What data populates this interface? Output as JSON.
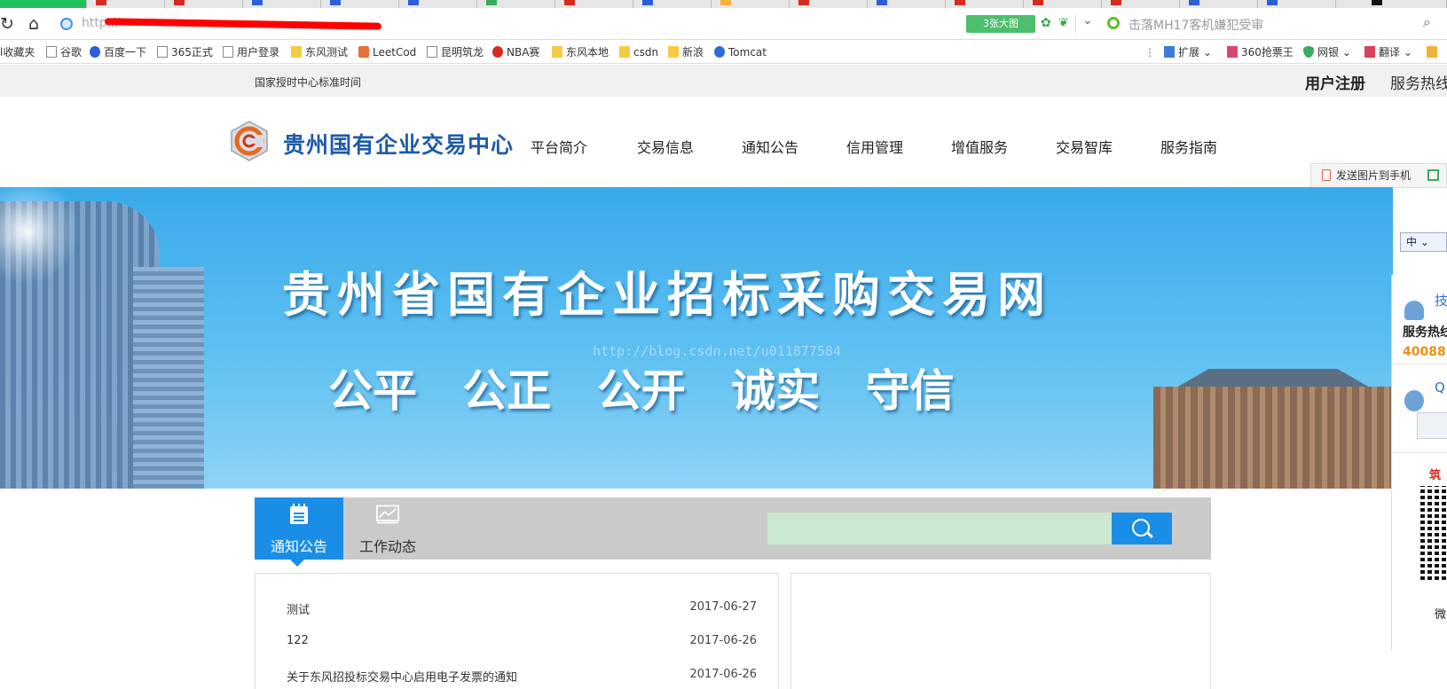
{
  "browser": {
    "url_prefix": "http://",
    "big_image_label": "3张大图",
    "search_news": "击落MH17客机嫌犯受审",
    "bookmarks": [
      {
        "label": "l收藏夹",
        "icon": "none"
      },
      {
        "label": "谷歌",
        "icon": "page"
      },
      {
        "label": "百度一下",
        "icon": "paw"
      },
      {
        "label": "365正式",
        "icon": "page"
      },
      {
        "label": "用户登录",
        "icon": "page"
      },
      {
        "label": "东风测试",
        "icon": "folder"
      },
      {
        "label": "LeetCod",
        "icon": "lc"
      },
      {
        "label": "昆明筑龙",
        "icon": "page"
      },
      {
        "label": "NBA赛",
        "icon": "weibo"
      },
      {
        "label": "东风本地",
        "icon": "folder"
      },
      {
        "label": "csdn",
        "icon": "folder"
      },
      {
        "label": "新浪",
        "icon": "folder"
      },
      {
        "label": "Tomcat",
        "icon": "tom"
      }
    ],
    "right_tools": [
      {
        "label": "扩展",
        "icon": "grid"
      },
      {
        "label": "360抢票王",
        "icon": "ticket"
      },
      {
        "label": "网银",
        "icon": "shield"
      },
      {
        "label": "翻译",
        "icon": "tr"
      },
      {
        "label": "",
        "icon": "box"
      }
    ],
    "send_to_phone": "发送图片到手机"
  },
  "topbar": {
    "time_label": "国家授时中心标准时间",
    "register": "用户注册",
    "hotline": "服务热线"
  },
  "header": {
    "site_title": "贵州国有企业交易中心",
    "nav": [
      "平台简介",
      "交易信息",
      "通知公告",
      "信用管理",
      "增值服务",
      "交易智库",
      "服务指南"
    ]
  },
  "banner": {
    "title": "贵州省国有企业招标采购交易网",
    "slogan": "公平 公正 公开 诚实 守信",
    "watermark": "http://blog.csdn.net/u011877584"
  },
  "float_panel": {
    "lang": "中",
    "tech": "技",
    "hotline": "服务热线",
    "number": "40088",
    "qq": "Q",
    "zhu": "筑",
    "wei": "微"
  },
  "tabs": [
    {
      "label": "通知公告",
      "active": true,
      "icon": "notice-icon"
    },
    {
      "label": "工作动态",
      "active": false,
      "icon": "chart-icon"
    }
  ],
  "search": {
    "placeholder": "",
    "value": ""
  },
  "notices": [
    {
      "title": "测试",
      "date": "2017-06-27"
    },
    {
      "title": "122",
      "date": "2017-06-26"
    },
    {
      "title": "关于东风招投标交易中心启用电子发票的通知",
      "date": "2017-06-26"
    }
  ],
  "colors": {
    "accent": "#1a8ee6",
    "brand": "#1d5ba8",
    "hotline_number": "#f08c10"
  }
}
